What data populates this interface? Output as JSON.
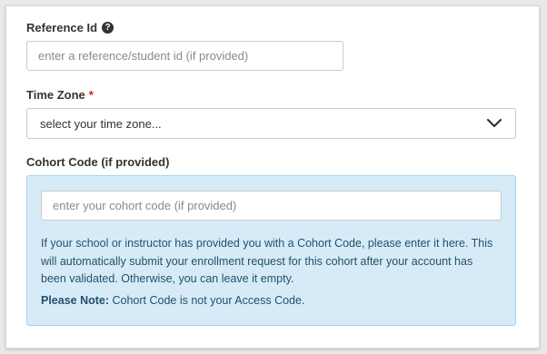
{
  "reference": {
    "label": "Reference Id",
    "help_icon": "question-circle-icon",
    "help_glyph": "?",
    "placeholder": "enter a reference/student id (if provided)"
  },
  "timezone": {
    "label": "Time Zone",
    "required_mark": "*",
    "selected": "select your time zone...",
    "chevron_icon": "chevron-down-icon"
  },
  "cohort": {
    "label": "Cohort Code (if provided)",
    "placeholder": "enter your cohort code (if provided)",
    "info_text": "If your school or instructor has provided you with a Cohort Code, please enter it here. This will automatically submit your enrollment request for this cohort after your account has been validated. Otherwise, you can leave it empty.",
    "note_label": "Please Note:",
    "note_text": " Cohort Code is not your Access Code."
  },
  "colors": {
    "required": "#cc1f1f",
    "info_bg": "#d6ebf7",
    "info_border": "#a9d2ea",
    "info_text": "#24506e"
  }
}
